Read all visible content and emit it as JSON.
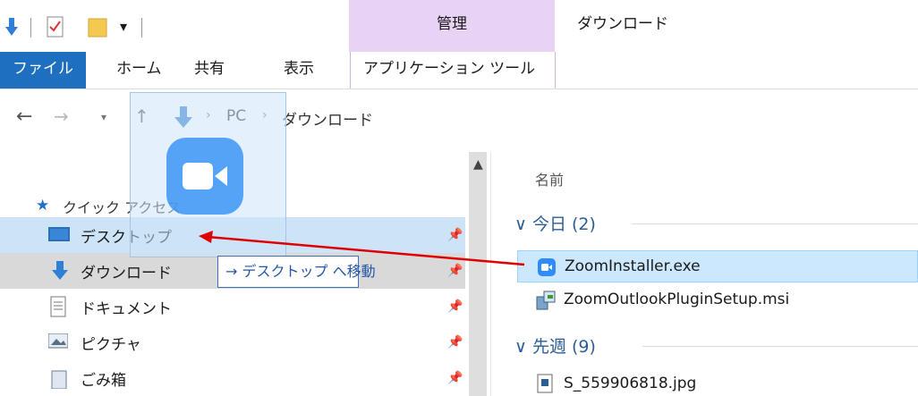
{
  "ribbon": {
    "context_group": "管理",
    "window_title": "ダウンロード",
    "tabs": [
      "ファイル",
      "ホーム",
      "共有",
      "表示",
      "アプリケーション ツール"
    ]
  },
  "address": {
    "crumbs": [
      "PC",
      "ダウンロード"
    ]
  },
  "nav": {
    "quick_access": "クイック アクセス",
    "items": [
      {
        "label": "デスクトップ",
        "icon": "desktop-icon"
      },
      {
        "label": "ダウンロード",
        "icon": "download-icon"
      },
      {
        "label": "ドキュメント",
        "icon": "documents-icon"
      },
      {
        "label": "ピクチャ",
        "icon": "pictures-icon"
      },
      {
        "label": "ごみ箱",
        "icon": "recycle-bin-icon"
      }
    ]
  },
  "files": {
    "column_name": "名前",
    "groups": [
      {
        "label": "今日 (2)",
        "items": [
          "ZoomInstaller.exe",
          "ZoomOutlookPluginSetup.msi"
        ]
      },
      {
        "label": "先週 (9)",
        "items": [
          "S_559906818.jpg"
        ]
      }
    ]
  },
  "drag": {
    "tooltip": "→ デスクトップ へ移動",
    "accent": "#e00000"
  },
  "colors": {
    "file_tab": "#1e6fbf",
    "context_tab": "#e8d3f4",
    "selection": "#cce8ff"
  }
}
